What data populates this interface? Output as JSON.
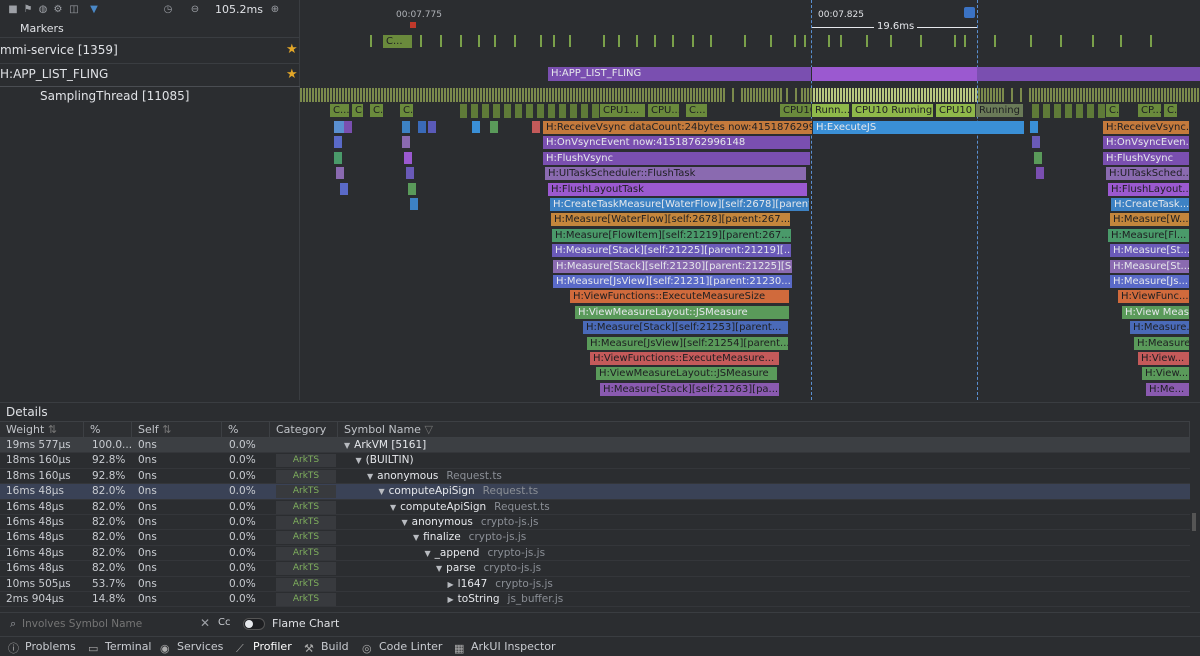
{
  "toolbar": {
    "zoom_value": "105.2ms"
  },
  "rows": {
    "markers_label": "Markers",
    "mmi_label": "mmi-service [1359]",
    "fling_label": "H:APP_LIST_FLING",
    "sampling_label": "SamplingThread [11085]"
  },
  "timeline": {
    "time_left": "00:07.775",
    "time_right": "00:07.825",
    "range_width": "19.6ms",
    "fling_block": "H:APP_LIST_FLING",
    "mmi_block_short": "C...",
    "state_blocks": [
      "C...",
      "C...",
      "C...",
      "C...",
      "CPU1...",
      "CPU...",
      "C...",
      "CPU10",
      "Runn...",
      "CPU10 Running",
      "CPU10",
      "Running",
      "C...",
      "CP...",
      "C..."
    ],
    "trace_main": [
      "H:ReceiveVsync dataCount:24bytes now:41518762996...",
      "H:OnVsyncEvent now:41518762996148",
      "H:FlushVsync",
      "H:UITaskScheduler::FlushTask",
      "H:FlushLayoutTask",
      "H:CreateTaskMeasure[WaterFlow][self:2678][parent:...",
      "H:Measure[WaterFlow][self:2678][parent:267...",
      "H:Measure[FlowItem][self:21219][parent:267...",
      "H:Measure[Stack][self:21225][parent:21219][...",
      "H:Measure[Stack][self:21230][parent:21225][S...",
      "H:Measure[JsView][self:21231][parent:21230...",
      "H:ViewFunctions::ExecuteMeasureSize",
      "H:ViewMeasureLayout::JSMeasure",
      "H:Measure[Stack][self:21253][parent...",
      "H:Measure[JsView][self:21254][parent...",
      "H:ViewFunctions::ExecuteMeasure...",
      "H:ViewMeasureLayout::JSMeasure",
      "H:Measure[Stack][self:21263][pa..."
    ],
    "trace_execute": "H:ExecuteJS",
    "trace_right": [
      "H:ReceiveVsync...",
      "H:OnVsyncEven...",
      "H:FlushVsync",
      "H:UITaskSched...",
      "H:FlushLayout...",
      "H:CreateTask...",
      "H:Measure[W...",
      "H:Measure[Fl...",
      "H:Measure[St...",
      "H:Measure[St...",
      "H:Measure[Js...",
      "H:ViewFunc...",
      "H:View Measu...",
      "H:Measure...",
      "H:Measure...",
      "H:View...",
      "H:View...",
      "H:Me..."
    ]
  },
  "details": {
    "title": "Details",
    "headers": [
      "Weight",
      "%",
      "Self",
      "%",
      "Category",
      "Symbol Name"
    ],
    "rows": [
      {
        "weight": "19ms 577μs",
        "pct": "100.0...",
        "self": "0ns",
        "spct": "0.0%",
        "cat": "",
        "indent": 0,
        "expand": "▼",
        "sym": "ArkVM [5161]",
        "file": ""
      },
      {
        "weight": "18ms 160μs",
        "pct": "92.8%",
        "self": "0ns",
        "spct": "0.0%",
        "cat": "ArkTS",
        "indent": 1,
        "expand": "▼",
        "sym": "(BUILTIN)",
        "file": ""
      },
      {
        "weight": "18ms 160μs",
        "pct": "92.8%",
        "self": "0ns",
        "spct": "0.0%",
        "cat": "ArkTS",
        "indent": 2,
        "expand": "▼",
        "sym": "anonymous",
        "file": "Request.ts"
      },
      {
        "weight": "16ms 48μs",
        "pct": "82.0%",
        "self": "0ns",
        "spct": "0.0%",
        "cat": "ArkTS",
        "indent": 3,
        "expand": "▼",
        "sym": "computeApiSign",
        "file": "Request.ts"
      },
      {
        "weight": "16ms 48μs",
        "pct": "82.0%",
        "self": "0ns",
        "spct": "0.0%",
        "cat": "ArkTS",
        "indent": 4,
        "expand": "▼",
        "sym": "computeApiSign",
        "file": "Request.ts"
      },
      {
        "weight": "16ms 48μs",
        "pct": "82.0%",
        "self": "0ns",
        "spct": "0.0%",
        "cat": "ArkTS",
        "indent": 5,
        "expand": "▼",
        "sym": "anonymous",
        "file": "crypto-js.js"
      },
      {
        "weight": "16ms 48μs",
        "pct": "82.0%",
        "self": "0ns",
        "spct": "0.0%",
        "cat": "ArkTS",
        "indent": 6,
        "expand": "▼",
        "sym": "finalize",
        "file": "crypto-js.js"
      },
      {
        "weight": "16ms 48μs",
        "pct": "82.0%",
        "self": "0ns",
        "spct": "0.0%",
        "cat": "ArkTS",
        "indent": 7,
        "expand": "▼",
        "sym": "_append",
        "file": "crypto-js.js"
      },
      {
        "weight": "16ms 48μs",
        "pct": "82.0%",
        "self": "0ns",
        "spct": "0.0%",
        "cat": "ArkTS",
        "indent": 8,
        "expand": "▼",
        "sym": "parse",
        "file": "crypto-js.js"
      },
      {
        "weight": "10ms 505μs",
        "pct": "53.7%",
        "self": "0ns",
        "spct": "0.0%",
        "cat": "ArkTS",
        "indent": 9,
        "expand": "▶",
        "sym": "l1647",
        "file": "crypto-js.js"
      },
      {
        "weight": "2ms 904μs",
        "pct": "14.8%",
        "self": "0ns",
        "spct": "0.0%",
        "cat": "ArkTS",
        "indent": 9,
        "expand": "▶",
        "sym": "toString",
        "file": "js_buffer.js"
      }
    ]
  },
  "search": {
    "placeholder": "Involves Symbol Name",
    "case_label": "Cc",
    "flame_label": "Flame Chart"
  },
  "status": [
    "Problems",
    "Terminal",
    "Services",
    "Profiler",
    "Build",
    "Code Linter",
    "ArkUI Inspector"
  ],
  "colors": {
    "accent": "#4a88c7",
    "selection": "#9b59d0",
    "running": "#7a9a3c"
  }
}
